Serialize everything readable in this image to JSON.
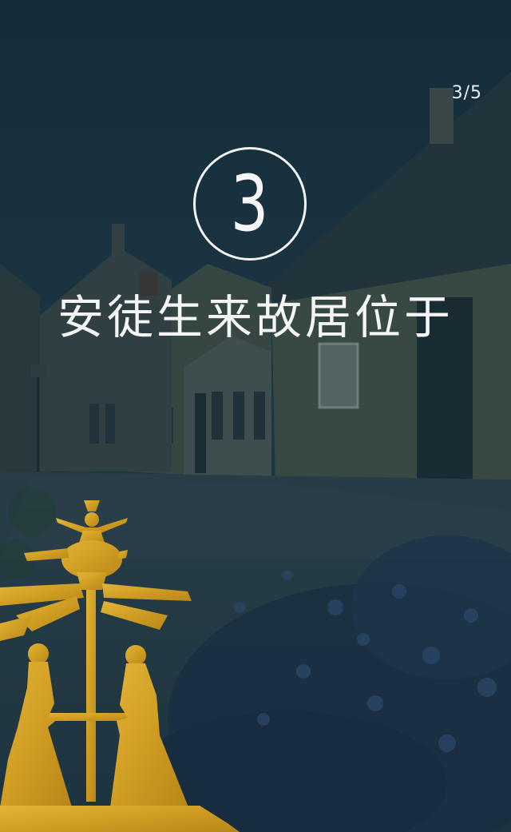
{
  "pager": {
    "text": "3/5"
  },
  "step": {
    "number": "3"
  },
  "headline": {
    "text": "安徒生来故居位于"
  },
  "colors": {
    "overlay": "#1c3440",
    "text": "#f4f4f4",
    "gold": "#d8a62a"
  },
  "icons": {
    "papercut": "andersen-papercut-illustration"
  }
}
